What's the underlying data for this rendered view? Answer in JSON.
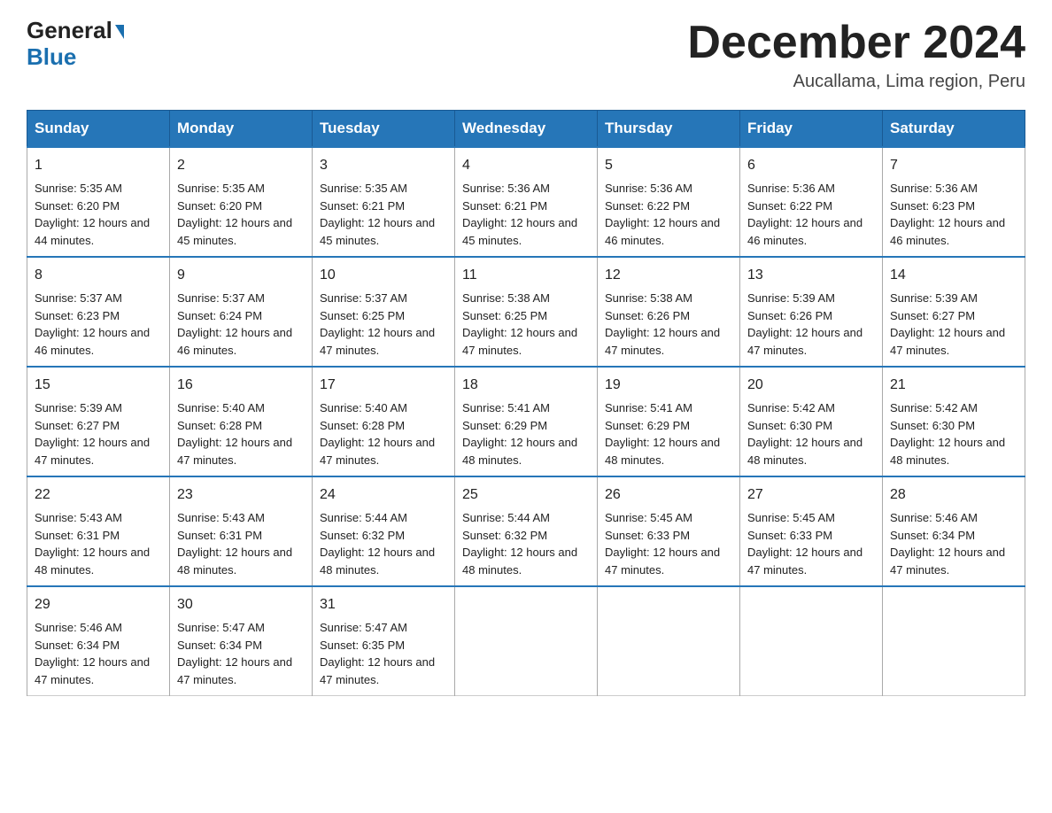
{
  "header": {
    "logo_line1": "General",
    "logo_line2": "Blue",
    "title": "December 2024",
    "subtitle": "Aucallama, Lima region, Peru"
  },
  "weekdays": [
    "Sunday",
    "Monday",
    "Tuesday",
    "Wednesday",
    "Thursday",
    "Friday",
    "Saturday"
  ],
  "weeks": [
    [
      {
        "day": "1",
        "sunrise": "5:35 AM",
        "sunset": "6:20 PM",
        "daylight": "12 hours and 44 minutes."
      },
      {
        "day": "2",
        "sunrise": "5:35 AM",
        "sunset": "6:20 PM",
        "daylight": "12 hours and 45 minutes."
      },
      {
        "day": "3",
        "sunrise": "5:35 AM",
        "sunset": "6:21 PM",
        "daylight": "12 hours and 45 minutes."
      },
      {
        "day": "4",
        "sunrise": "5:36 AM",
        "sunset": "6:21 PM",
        "daylight": "12 hours and 45 minutes."
      },
      {
        "day": "5",
        "sunrise": "5:36 AM",
        "sunset": "6:22 PM",
        "daylight": "12 hours and 46 minutes."
      },
      {
        "day": "6",
        "sunrise": "5:36 AM",
        "sunset": "6:22 PM",
        "daylight": "12 hours and 46 minutes."
      },
      {
        "day": "7",
        "sunrise": "5:36 AM",
        "sunset": "6:23 PM",
        "daylight": "12 hours and 46 minutes."
      }
    ],
    [
      {
        "day": "8",
        "sunrise": "5:37 AM",
        "sunset": "6:23 PM",
        "daylight": "12 hours and 46 minutes."
      },
      {
        "day": "9",
        "sunrise": "5:37 AM",
        "sunset": "6:24 PM",
        "daylight": "12 hours and 46 minutes."
      },
      {
        "day": "10",
        "sunrise": "5:37 AM",
        "sunset": "6:25 PM",
        "daylight": "12 hours and 47 minutes."
      },
      {
        "day": "11",
        "sunrise": "5:38 AM",
        "sunset": "6:25 PM",
        "daylight": "12 hours and 47 minutes."
      },
      {
        "day": "12",
        "sunrise": "5:38 AM",
        "sunset": "6:26 PM",
        "daylight": "12 hours and 47 minutes."
      },
      {
        "day": "13",
        "sunrise": "5:39 AM",
        "sunset": "6:26 PM",
        "daylight": "12 hours and 47 minutes."
      },
      {
        "day": "14",
        "sunrise": "5:39 AM",
        "sunset": "6:27 PM",
        "daylight": "12 hours and 47 minutes."
      }
    ],
    [
      {
        "day": "15",
        "sunrise": "5:39 AM",
        "sunset": "6:27 PM",
        "daylight": "12 hours and 47 minutes."
      },
      {
        "day": "16",
        "sunrise": "5:40 AM",
        "sunset": "6:28 PM",
        "daylight": "12 hours and 47 minutes."
      },
      {
        "day": "17",
        "sunrise": "5:40 AM",
        "sunset": "6:28 PM",
        "daylight": "12 hours and 47 minutes."
      },
      {
        "day": "18",
        "sunrise": "5:41 AM",
        "sunset": "6:29 PM",
        "daylight": "12 hours and 48 minutes."
      },
      {
        "day": "19",
        "sunrise": "5:41 AM",
        "sunset": "6:29 PM",
        "daylight": "12 hours and 48 minutes."
      },
      {
        "day": "20",
        "sunrise": "5:42 AM",
        "sunset": "6:30 PM",
        "daylight": "12 hours and 48 minutes."
      },
      {
        "day": "21",
        "sunrise": "5:42 AM",
        "sunset": "6:30 PM",
        "daylight": "12 hours and 48 minutes."
      }
    ],
    [
      {
        "day": "22",
        "sunrise": "5:43 AM",
        "sunset": "6:31 PM",
        "daylight": "12 hours and 48 minutes."
      },
      {
        "day": "23",
        "sunrise": "5:43 AM",
        "sunset": "6:31 PM",
        "daylight": "12 hours and 48 minutes."
      },
      {
        "day": "24",
        "sunrise": "5:44 AM",
        "sunset": "6:32 PM",
        "daylight": "12 hours and 48 minutes."
      },
      {
        "day": "25",
        "sunrise": "5:44 AM",
        "sunset": "6:32 PM",
        "daylight": "12 hours and 48 minutes."
      },
      {
        "day": "26",
        "sunrise": "5:45 AM",
        "sunset": "6:33 PM",
        "daylight": "12 hours and 47 minutes."
      },
      {
        "day": "27",
        "sunrise": "5:45 AM",
        "sunset": "6:33 PM",
        "daylight": "12 hours and 47 minutes."
      },
      {
        "day": "28",
        "sunrise": "5:46 AM",
        "sunset": "6:34 PM",
        "daylight": "12 hours and 47 minutes."
      }
    ],
    [
      {
        "day": "29",
        "sunrise": "5:46 AM",
        "sunset": "6:34 PM",
        "daylight": "12 hours and 47 minutes."
      },
      {
        "day": "30",
        "sunrise": "5:47 AM",
        "sunset": "6:34 PM",
        "daylight": "12 hours and 47 minutes."
      },
      {
        "day": "31",
        "sunrise": "5:47 AM",
        "sunset": "6:35 PM",
        "daylight": "12 hours and 47 minutes."
      },
      null,
      null,
      null,
      null
    ]
  ],
  "labels": {
    "sunrise": "Sunrise:",
    "sunset": "Sunset:",
    "daylight": "Daylight:"
  }
}
